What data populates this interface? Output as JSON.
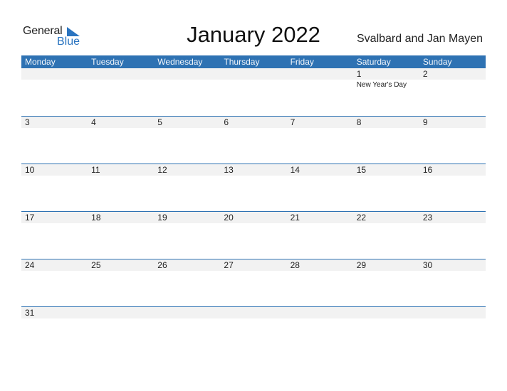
{
  "logo": {
    "general": "General",
    "blue": "Blue"
  },
  "title": "January 2022",
  "country": "Svalbard and Jan Mayen",
  "weekdays": [
    "Monday",
    "Tuesday",
    "Wednesday",
    "Thursday",
    "Friday",
    "Saturday",
    "Sunday"
  ],
  "weeks": [
    {
      "days": [
        "",
        "",
        "",
        "",
        "",
        "1",
        "2"
      ],
      "events": [
        "",
        "",
        "",
        "",
        "",
        "New Year's Day",
        ""
      ]
    },
    {
      "days": [
        "3",
        "4",
        "5",
        "6",
        "7",
        "8",
        "9"
      ],
      "events": [
        "",
        "",
        "",
        "",
        "",
        "",
        ""
      ]
    },
    {
      "days": [
        "10",
        "11",
        "12",
        "13",
        "14",
        "15",
        "16"
      ],
      "events": [
        "",
        "",
        "",
        "",
        "",
        "",
        ""
      ]
    },
    {
      "days": [
        "17",
        "18",
        "19",
        "20",
        "21",
        "22",
        "23"
      ],
      "events": [
        "",
        "",
        "",
        "",
        "",
        "",
        ""
      ]
    },
    {
      "days": [
        "24",
        "25",
        "26",
        "27",
        "28",
        "29",
        "30"
      ],
      "events": [
        "",
        "",
        "",
        "",
        "",
        "",
        ""
      ]
    },
    {
      "days": [
        "31",
        "",
        "",
        "",
        "",
        "",
        ""
      ],
      "events": [
        "",
        "",
        "",
        "",
        "",
        "",
        ""
      ]
    }
  ],
  "colors": {
    "accent": "#2e72b3",
    "logo_blue": "#2a74c0",
    "day_strip": "#f2f2f2"
  }
}
